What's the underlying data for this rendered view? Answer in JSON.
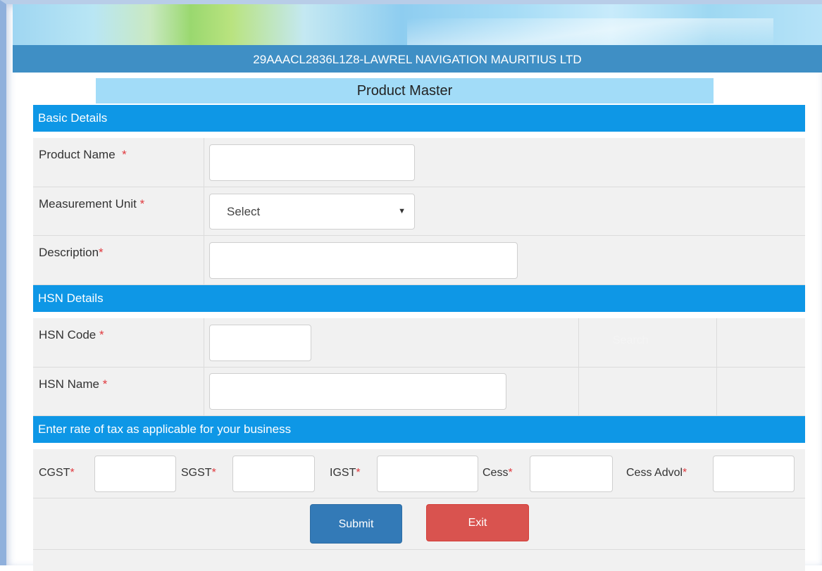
{
  "header": {
    "company": "29AAACL2836L1Z8-LAWREL NAVIGATION MAURITIUS LTD",
    "page_title": "Product Master"
  },
  "basic_details": {
    "heading": "Basic Details",
    "product_name_label": "Product Name",
    "product_name_value": "",
    "measurement_unit_label": "Measurement Unit",
    "measurement_unit_selected": "Select",
    "description_label": "Description",
    "description_value": ""
  },
  "hsn_details": {
    "heading": "HSN Details",
    "hsn_code_label": "HSN Code",
    "hsn_code_value": "",
    "search_label": "Search",
    "hsn_name_label": "HSN Name",
    "hsn_name_value": ""
  },
  "tax": {
    "heading": "Enter rate of tax as applicable for your business",
    "fields": [
      {
        "label": "CGST",
        "value": ""
      },
      {
        "label": "SGST",
        "value": ""
      },
      {
        "label": "IGST",
        "value": ""
      },
      {
        "label": "Cess",
        "value": ""
      },
      {
        "label": "Cess Advol",
        "value": ""
      }
    ]
  },
  "actions": {
    "submit_label": "Submit",
    "exit_label": "Exit"
  },
  "required_mark": "*",
  "icons": {
    "select_caret": "caret-down-icon"
  },
  "colors": {
    "section_header": "#0e97e6",
    "company_bar": "#3f8fc5",
    "title_bar": "#a2dcf8",
    "required": "#e0393e",
    "submit": "#337ab7",
    "exit": "#d9534f"
  }
}
